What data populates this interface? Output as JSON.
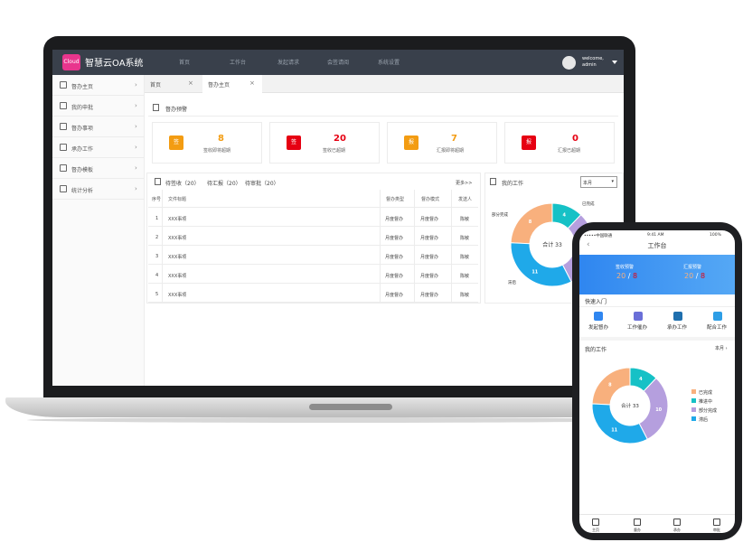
{
  "colors": {
    "topbar": "#39404b",
    "brand_pink": "#e8358d",
    "orange": "#f39c12",
    "red": "#e60012",
    "chart_orange": "#f8b07d",
    "chart_teal": "#16c1c6",
    "chart_purple": "#b59fde",
    "chart_blue": "#1fa9e9",
    "phone_blue": "#2f86f0"
  },
  "desktop": {
    "app_title": "智慧云OA系统",
    "logo_text": "Cloud",
    "nav": [
      "首页",
      "工作台",
      "发起请求",
      "会签请阅",
      "系统设置"
    ],
    "welcome": "welcome,",
    "user": "admin",
    "sidebar": [
      {
        "label": "督办主页",
        "icon": "home-icon"
      },
      {
        "label": "我的申批",
        "icon": "approval-icon"
      },
      {
        "label": "督办事项",
        "icon": "task-icon"
      },
      {
        "label": "承办工作",
        "icon": "work-icon"
      },
      {
        "label": "督办模板",
        "icon": "template-icon"
      },
      {
        "label": "统计分析",
        "icon": "stats-icon"
      }
    ],
    "tabs": [
      {
        "label": "首页",
        "close": "×"
      },
      {
        "label": "督办主页",
        "close": "×"
      }
    ],
    "warning_title": "督办预警",
    "cards": [
      {
        "badge": "签",
        "number": "8",
        "caption": "签收即将超期",
        "color": "#f39c12"
      },
      {
        "badge": "签",
        "number": "20",
        "caption": "签收已超期",
        "color": "#e60012"
      },
      {
        "badge": "报",
        "number": "7",
        "caption": "汇报即将超期",
        "color": "#f39c12"
      },
      {
        "badge": "报",
        "number": "0",
        "caption": "汇报已超期",
        "color": "#e60012"
      }
    ],
    "list_tabs": [
      "待签收（20）",
      "待汇报（20）",
      "待审批（20）"
    ],
    "more": "更多>>",
    "table": {
      "headers": [
        "序号",
        "文件标题",
        "督办类型",
        "督办模式",
        "发送人"
      ],
      "rows": [
        [
          "1",
          "XXX事项",
          "月度督办",
          "月度督办",
          "陈敏"
        ],
        [
          "2",
          "XXX事项",
          "月度督办",
          "月度督办",
          "陈敏"
        ],
        [
          "3",
          "XXX事项",
          "月度督办",
          "月度督办",
          "陈敏"
        ],
        [
          "4",
          "XXX事项",
          "月度督办",
          "月度督办",
          "陈敏"
        ],
        [
          "5",
          "XXX事项",
          "月度督办",
          "月度督办",
          "陈敏"
        ]
      ]
    },
    "my_work": "我的工作",
    "period": "本月",
    "chart_total": "合计 33",
    "chart_labels": [
      "已完成",
      "部分完成",
      "滞后"
    ]
  },
  "mobile": {
    "carrier": "•••••中国联通",
    "time": "9:41 AM",
    "battery": "100%",
    "title": "工作台",
    "banner": [
      {
        "label": "签收预警",
        "a": "20",
        "b": "8"
      },
      {
        "label": "汇报预警",
        "a": "20",
        "b": "8"
      }
    ],
    "quick_title": "快速入门",
    "quick": [
      "发起督办",
      "工作催办",
      "承办工作",
      "配合工作"
    ],
    "my_work": "我的工作",
    "period": "本月 ›",
    "chart_total": "合计 33",
    "legend": [
      "已完成",
      "推进中",
      "部分完成",
      "滞后"
    ],
    "tabbar": [
      "主页",
      "督办",
      "承办",
      "审批"
    ]
  },
  "chart_data": [
    {
      "type": "pie",
      "title": "我的工作",
      "categories": [
        "已完成",
        "推进中",
        "部分完成",
        "滞后"
      ],
      "values": [
        8,
        4,
        10,
        11
      ],
      "total_label": "合计 33"
    }
  ]
}
